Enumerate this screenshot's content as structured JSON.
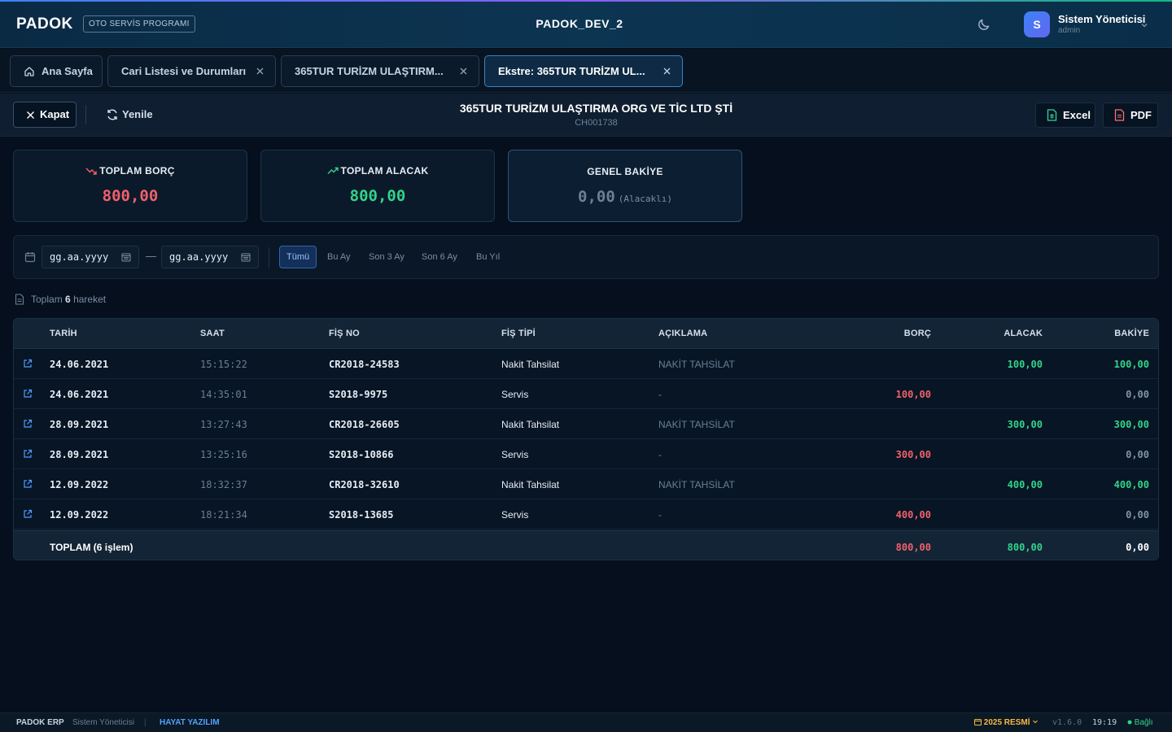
{
  "topbar": {
    "brand": "PADOK",
    "brand_badge": "OTO SERVİS PROGRAMI",
    "app_title": "PADOK_DEV_2",
    "user_initial": "S",
    "user_name": "Sistem Yöneticisi",
    "user_role": "admin"
  },
  "tabs": [
    {
      "label": "Ana Sayfa"
    },
    {
      "label": "Cari Listesi ve Durumları"
    },
    {
      "label": "365TUR TURİZM ULAŞTIRM..."
    },
    {
      "label": "Ekstre: 365TUR TURİZM UL..."
    }
  ],
  "header": {
    "close_label": "Kapat",
    "refresh_label": "Yenile",
    "title": "365TUR TURİZM ULAŞTIRMA ORG VE TİC LTD ŞTİ",
    "code": "CH001738",
    "excel_label": "Excel",
    "pdf_label": "PDF"
  },
  "summary": {
    "borc_label": "TOPLAM BORÇ",
    "borc_value": "800,00",
    "alacak_label": "TOPLAM ALACAK",
    "alacak_value": "800,00",
    "bakiye_label": "GENEL BAKİYE",
    "bakiye_value": "0,00",
    "bakiye_sub": "(Alacaklı)"
  },
  "filter": {
    "start_placeholder": "gg.aa.yyyy",
    "end_placeholder": "gg.aa.yyyy",
    "separator": "—",
    "chips": [
      "Tümü",
      "Bu Ay",
      "Son 3 Ay",
      "Son 6 Ay",
      "Bu Yıl"
    ]
  },
  "count": {
    "prefix": "Toplam",
    "value": "6",
    "suffix": "hareket"
  },
  "table": {
    "headers": [
      "TARİH",
      "SAAT",
      "FİŞ NO",
      "FİŞ TİPİ",
      "AÇIKLAMA",
      "BORÇ",
      "ALACAK",
      "BAKİYE"
    ],
    "rows": [
      {
        "date": "24.06.2021",
        "time": "15:15:22",
        "fis_no": "CR2018-24583",
        "type": "Nakit Tahsilat",
        "desc": "NAKİT TAHSİLAT",
        "borc": "",
        "alacak": "100,00",
        "bakiye": "100,00"
      },
      {
        "date": "24.06.2021",
        "time": "14:35:01",
        "fis_no": "S2018-9975",
        "type": "Servis",
        "desc": "-",
        "borc": "100,00",
        "alacak": "",
        "bakiye": "0,00"
      },
      {
        "date": "28.09.2021",
        "time": "13:27:43",
        "fis_no": "CR2018-26605",
        "type": "Nakit Tahsilat",
        "desc": "NAKİT TAHSİLAT",
        "borc": "",
        "alacak": "300,00",
        "bakiye": "300,00"
      },
      {
        "date": "28.09.2021",
        "time": "13:25:16",
        "fis_no": "S2018-10866",
        "type": "Servis",
        "desc": "-",
        "borc": "300,00",
        "alacak": "",
        "bakiye": "0,00"
      },
      {
        "date": "12.09.2022",
        "time": "18:32:37",
        "fis_no": "CR2018-32610",
        "type": "Nakit Tahsilat",
        "desc": "NAKİT TAHSİLAT",
        "borc": "",
        "alacak": "400,00",
        "bakiye": "400,00"
      },
      {
        "date": "12.09.2022",
        "time": "18:21:34",
        "fis_no": "S2018-13685",
        "type": "Servis",
        "desc": "-",
        "borc": "400,00",
        "alacak": "",
        "bakiye": "0,00"
      }
    ],
    "footer": {
      "label": "TOPLAM (6 işlem)",
      "borc": "800,00",
      "alacak": "800,00",
      "bakiye": "0,00"
    }
  },
  "statusbar": {
    "app": "PADOK ERP",
    "user": "Sistem Yöneticisi",
    "separator": "|",
    "company": "HAYAT YAZILIM",
    "period": "2025 RESMİ",
    "version": "v1.6.0",
    "time": "19:19",
    "connection": "Bağlı"
  },
  "colors": {
    "borc": "#f0616b",
    "alacak": "#32d48a",
    "accent": "#3b82f6",
    "background": "#050f1d"
  }
}
